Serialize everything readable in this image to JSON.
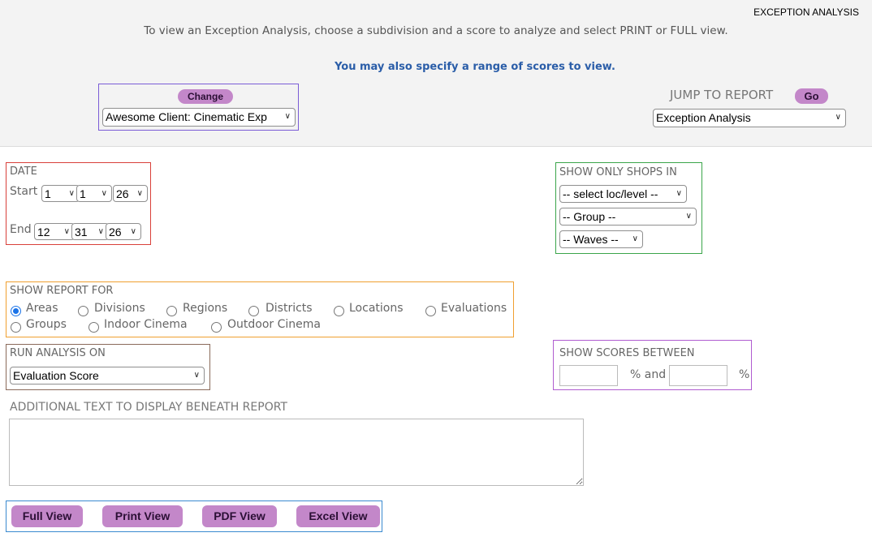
{
  "page_title": "EXCEPTION ANALYSIS",
  "intro_text": "To view an Exception Analysis, choose a subdivision and a score to analyze and select PRINT or FULL view.",
  "intro_note": "You may also specify a range of scores to view.",
  "client": {
    "change_label": "Change",
    "selected": "Awesome Client: Cinematic Exp"
  },
  "jump": {
    "label": "JUMP TO REPORT",
    "go_label": "Go",
    "selected": "Exception Analysis"
  },
  "date": {
    "label": "DATE",
    "start_label": "Start",
    "start_month": "1",
    "start_day": "1",
    "start_year": "26",
    "end_label": "End",
    "end_month": "12",
    "end_day": "31",
    "end_year": "26"
  },
  "shops": {
    "label": "SHOW ONLY SHOPS IN",
    "loc_level": "-- select loc/level --",
    "group": "-- Group --",
    "waves": "-- Waves --"
  },
  "report_for": {
    "label": "SHOW REPORT FOR",
    "options": [
      "Areas",
      "Divisions",
      "Regions",
      "Districts",
      "Locations",
      "Evaluations",
      "Groups",
      "Indoor Cinema",
      "Outdoor Cinema"
    ],
    "selected": "Areas"
  },
  "analysis": {
    "label": "RUN ANALYSIS ON",
    "selected": "Evaluation Score"
  },
  "scores": {
    "label": "SHOW SCORES BETWEEN",
    "from_value": "",
    "and_text": "% and",
    "to_value": "",
    "pct": "%"
  },
  "additional": {
    "label": "ADDITIONAL TEXT TO DISPLAY BENEATH REPORT",
    "value": ""
  },
  "buttons": {
    "full": "Full View",
    "print": "Print View",
    "pdf": "PDF View",
    "excel": "Excel View"
  },
  "colors": {
    "pill": "#c387c9",
    "blue_note": "#2a5da8",
    "client_border": "#7b5cd6",
    "date_border": "#d9403a",
    "shops_border": "#3aa54a",
    "report_border": "#f0a030",
    "analysis_border": "#8a6a5a",
    "scores_border": "#b05cd0",
    "buttons_border": "#3a8ad0"
  }
}
